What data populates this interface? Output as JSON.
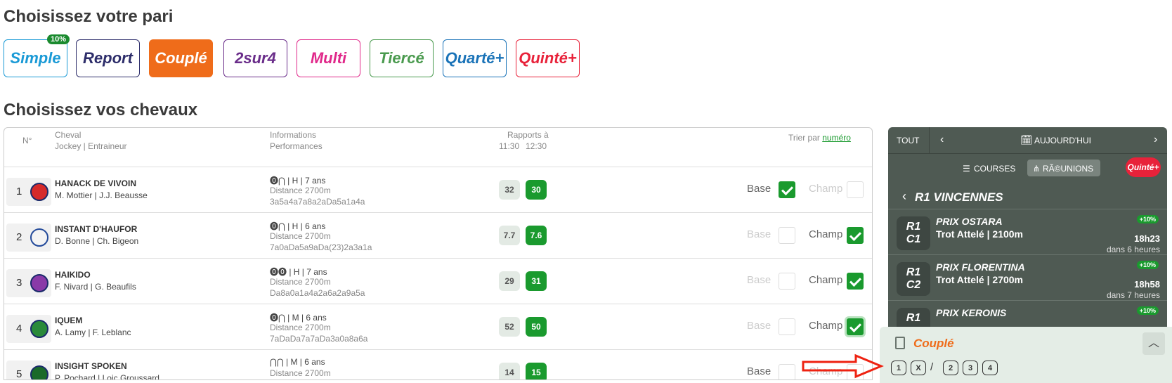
{
  "title_pari": "Choisissez votre pari",
  "title_chevaux": "Choisissez vos chevaux",
  "bet_types": [
    {
      "label": "Simple",
      "color": "#1a9ad6",
      "badge": "10%"
    },
    {
      "label": "Report",
      "color": "#2d2d6a"
    },
    {
      "label": "Couplé",
      "color": "#ef6c1a",
      "selected": true
    },
    {
      "label": "2sur4",
      "color": "#6a2d8a"
    },
    {
      "label": "Multi",
      "color": "#e0288a"
    },
    {
      "label": "Tiercé",
      "color": "#4a9a4e"
    },
    {
      "label": "Quarté+",
      "color": "#1a73b8"
    },
    {
      "label": "Quinté+",
      "color": "#e8223a"
    }
  ],
  "table": {
    "col_num": "N°",
    "col_cheval": "Cheval",
    "col_jockey": "Jockey | Entraineur",
    "col_info": "Informations",
    "col_perf": "Performances",
    "col_rapports": "Rapports à",
    "col_time1": "11:30",
    "col_time2": "12:30",
    "sort_prefix": "Trier par",
    "sort_link": "numéro",
    "label_base": "Base",
    "label_champ": "Champ",
    "rows": [
      {
        "num": "1",
        "name": "HANACK DE VIVOIN",
        "jockey": "M. Mottier | J.J. Beausse",
        "info": "⓿⋂ | H | 7 ans",
        "distance": "Distance 2700m",
        "perf": "3a5a4a7a8a2aDa5a1a4a",
        "odd1": "32",
        "odd2": "30",
        "base": true,
        "champ": false,
        "base_active": true
      },
      {
        "num": "2",
        "name": "INSTANT D'HAUFOR",
        "jockey": "D. Bonne | Ch. Bigeon",
        "info": "⓿⋂ | H | 6 ans",
        "distance": "Distance 2700m",
        "perf": "7a0aDa5a9aDa(23)2a3a1a",
        "odd1": "7.7",
        "odd2": "7.6",
        "base": false,
        "champ": true,
        "base_active": false
      },
      {
        "num": "3",
        "name": "HAIKIDO",
        "jockey": "F. Nivard | G. Beaufils",
        "info": "⓿⓿ | H | 7 ans",
        "distance": "Distance 2700m",
        "perf": "Da8a0a1a4a2a6a2a9a5a",
        "odd1": "29",
        "odd2": "31",
        "base": false,
        "champ": true,
        "base_active": false
      },
      {
        "num": "4",
        "name": "IQUEM",
        "jockey": "A. Lamy | F. Leblanc",
        "info": "⓿⋂ | M | 6 ans",
        "distance": "Distance 2700m",
        "perf": "7aDaDa7a7aDa3a0a8a6a",
        "odd1": "52",
        "odd2": "50",
        "base": false,
        "champ": true,
        "base_active": false
      },
      {
        "num": "5",
        "name": "INSIGHT SPOKEN",
        "jockey": "P. Pochard | Loic Groussard",
        "info": "⋂⋂ | M | 6 ans",
        "distance": "Distance 2700m",
        "perf": "",
        "odd1": "14",
        "odd2": "15",
        "base": false,
        "champ": false,
        "base_active": true
      }
    ]
  },
  "panel": {
    "tout": "TOUT",
    "date": "AUJOURD'HUI",
    "courses": "COURSES",
    "reunions": "RÃ©UNIONS",
    "quinte_badge": "Quinté+",
    "reunion_title": "R1  VINCENNES",
    "races": [
      {
        "code1": "R1",
        "code2": "C1",
        "name": "PRIX OSTARA",
        "type": "Trot Attelé | 2100m",
        "badge": "+10%",
        "time": "18h23",
        "in": "dans 6 heures"
      },
      {
        "code1": "R1",
        "code2": "C2",
        "name": "PRIX FLORENTINA",
        "type": "Trot Attelé | 2700m",
        "badge": "+10%",
        "time": "18h58",
        "in": "dans 7 heures"
      },
      {
        "code1": "R1",
        "code2": "",
        "name": "PRIX KERONIS",
        "type": "",
        "badge": "+10%",
        "time": "",
        "in": ""
      }
    ]
  },
  "cart": {
    "title": "Couplé",
    "pills": [
      "1",
      "X",
      "/",
      "2",
      "3",
      "4"
    ]
  }
}
